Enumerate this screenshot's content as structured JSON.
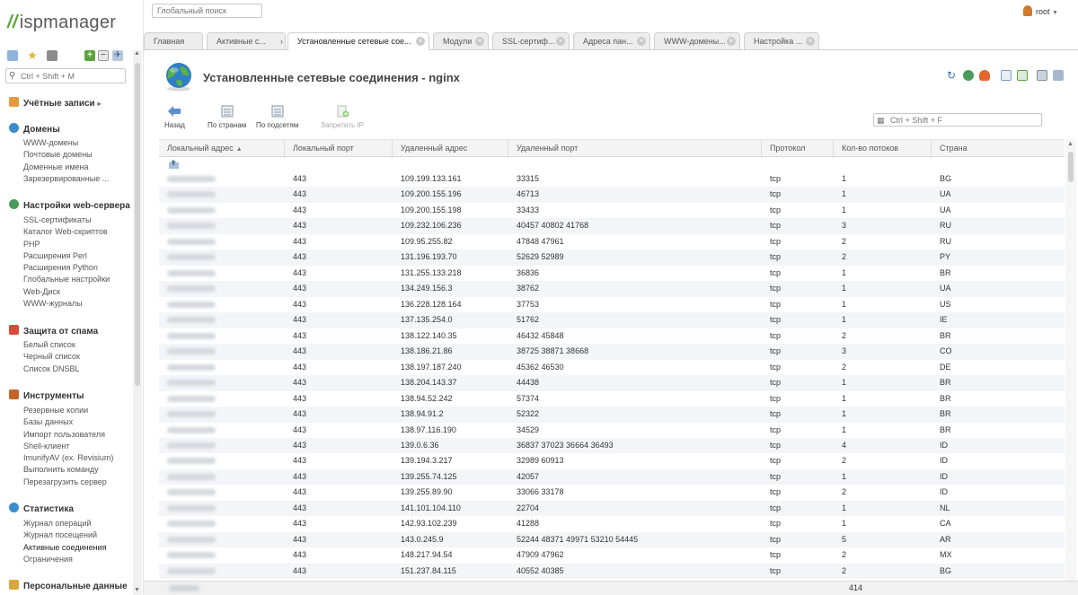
{
  "brand": {
    "logo_text": "ispmanager"
  },
  "header": {
    "global_search_placeholder": "Глобальный поиск",
    "user": "root"
  },
  "sidebar": {
    "search_placeholder": "Ctrl + Shift + M",
    "sections": [
      {
        "title": "Учётные записи",
        "icon": "users-icon",
        "color": "#e49b3c",
        "items": []
      },
      {
        "title": "Домены",
        "icon": "globe-icon",
        "color": "#3a8ccf",
        "items": [
          "WWW-домены",
          "Почтовые домены",
          "Доменные имена",
          "Зарезервированные ..."
        ]
      },
      {
        "title": "Настройки web-сервера",
        "icon": "globe-icon",
        "color": "#4a9a5c",
        "items": [
          "SSL-сертификаты",
          "Каталог Web-скриптов",
          "PHP",
          "Расширения Perl",
          "Расширения Python",
          "Глобальные настройки",
          "Web-Диск",
          "WWW-журналы"
        ]
      },
      {
        "title": "Защита от спама",
        "icon": "shield-icon",
        "color": "#d84b3a",
        "items": [
          "Белый список",
          "Черный список",
          "Список DNSBL"
        ]
      },
      {
        "title": "Инструменты",
        "icon": "tools-icon",
        "color": "#c2652b",
        "items": [
          "Резервные копии",
          "Базы данных",
          "Импорт пользователя",
          "Shell-клиент",
          "ImunifyAV (ex. Revisium)",
          "Выполнить команду",
          "Перезагрузить сервер"
        ]
      },
      {
        "title": "Статистика",
        "icon": "globe-icon",
        "color": "#3a8ccf",
        "items": [
          "Журнал операций",
          "Журнал посещений",
          "Активные соединения",
          "Ограничения"
        ]
      },
      {
        "title": "Персональные данные",
        "icon": "chart-icon",
        "color": "#d8a83a",
        "items": []
      }
    ]
  },
  "tabs": [
    {
      "label": "Главная"
    },
    {
      "label": "Активные с..."
    },
    {
      "label": "Установленные сетевые сое..."
    },
    {
      "label": "Модули"
    },
    {
      "label": "SSL-сертиф..."
    },
    {
      "label": "Адреса пан..."
    },
    {
      "label": "WWW-домены..."
    },
    {
      "label": "Настройка ..."
    }
  ],
  "main": {
    "title": "Установленные сетевые соединения - nginx",
    "toolbar": [
      {
        "label": "Назад",
        "icon": "back-arrow-icon"
      },
      {
        "label": "По странам",
        "icon": "list-icon"
      },
      {
        "label": "По подсетям",
        "icon": "list-icon"
      },
      {
        "label": "Запретить IP",
        "icon": "ban-ip-icon"
      }
    ],
    "table_search_placeholder": "Ctrl + Shift + F",
    "columns": [
      "Локальный адрес",
      "Локальный порт",
      "Удаленный адрес",
      "Удаленный порт",
      "Протокол",
      "Кол-во потоков",
      "Страна"
    ],
    "rows": [
      [
        "443",
        "109.199.133.161",
        "33315",
        "tcp",
        "1",
        "BG"
      ],
      [
        "443",
        "109.200.155.196",
        "46713",
        "tcp",
        "1",
        "UA"
      ],
      [
        "443",
        "109.200.155.198",
        "33433",
        "tcp",
        "1",
        "UA"
      ],
      [
        "443",
        "109.232.106.236",
        "40457 40802 41768",
        "tcp",
        "3",
        "RU"
      ],
      [
        "443",
        "109.95.255.82",
        "47848 47961",
        "tcp",
        "2",
        "RU"
      ],
      [
        "443",
        "131.196.193.70",
        "52629 52989",
        "tcp",
        "2",
        "PY"
      ],
      [
        "443",
        "131.255.133.218",
        "36836",
        "tcp",
        "1",
        "BR"
      ],
      [
        "443",
        "134.249.156.3",
        "38762",
        "tcp",
        "1",
        "UA"
      ],
      [
        "443",
        "136.228.128.164",
        "37753",
        "tcp",
        "1",
        "US"
      ],
      [
        "443",
        "137.135.254.0",
        "51762",
        "tcp",
        "1",
        "IE"
      ],
      [
        "443",
        "138.122.140.35",
        "46432 45848",
        "tcp",
        "2",
        "BR"
      ],
      [
        "443",
        "138.186.21.86",
        "38725 38871 38668",
        "tcp",
        "3",
        "CO"
      ],
      [
        "443",
        "138.197.187.240",
        "45362 46530",
        "tcp",
        "2",
        "DE"
      ],
      [
        "443",
        "138.204.143.37",
        "44438",
        "tcp",
        "1",
        "BR"
      ],
      [
        "443",
        "138.94.52.242",
        "57374",
        "tcp",
        "1",
        "BR"
      ],
      [
        "443",
        "138.94.91.2",
        "52322",
        "tcp",
        "1",
        "BR"
      ],
      [
        "443",
        "138.97.116.190",
        "34529",
        "tcp",
        "1",
        "BR"
      ],
      [
        "443",
        "139.0.6.36",
        "36837 37023 36664 36493",
        "tcp",
        "4",
        "ID"
      ],
      [
        "443",
        "139.194.3.217",
        "32989 60913",
        "tcp",
        "2",
        "ID"
      ],
      [
        "443",
        "139.255.74.125",
        "42057",
        "tcp",
        "1",
        "ID"
      ],
      [
        "443",
        "139.255.89.90",
        "33066 33178",
        "tcp",
        "2",
        "ID"
      ],
      [
        "443",
        "141.101.104.110",
        "22704",
        "tcp",
        "1",
        "NL"
      ],
      [
        "443",
        "142.93.102.239",
        "41288",
        "tcp",
        "1",
        "CA"
      ],
      [
        "443",
        "143.0.245.9",
        "52244 48371 49971 53210 54445",
        "tcp",
        "5",
        "AR"
      ],
      [
        "443",
        "148.217.94.54",
        "47909 47962",
        "tcp",
        "2",
        "MX"
      ],
      [
        "443",
        "151.237.84.115",
        "40552 40385",
        "tcp",
        "2",
        "BG"
      ]
    ],
    "footer_total": "414"
  }
}
